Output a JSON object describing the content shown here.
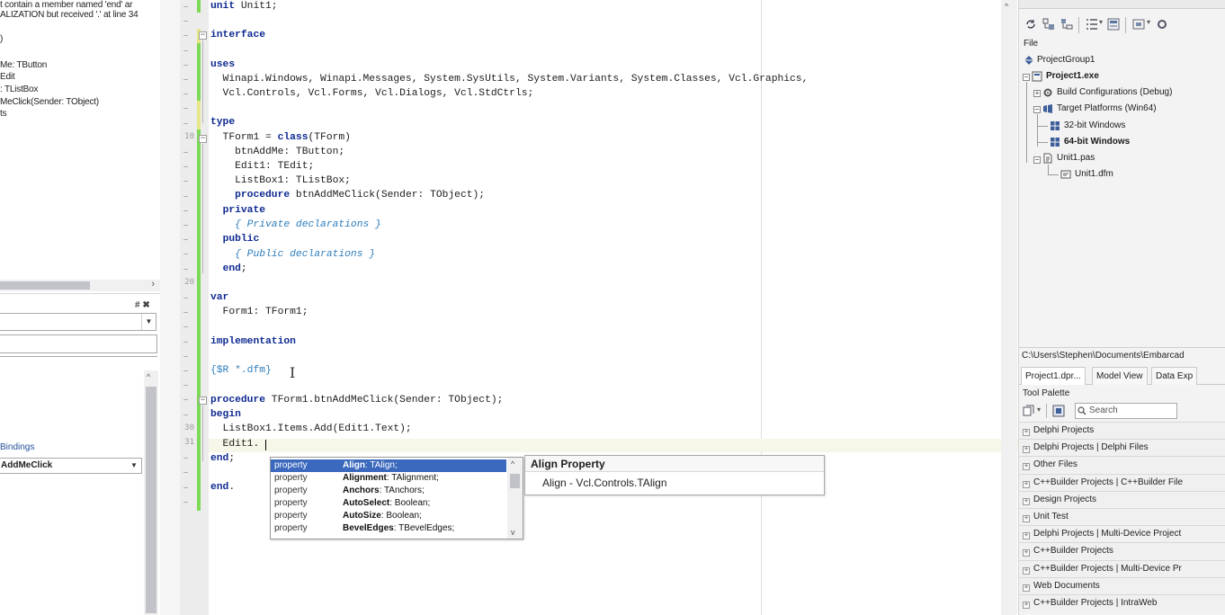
{
  "left_panel": {
    "lines": [
      "t contain a member named 'end' ar",
      "ALIZATION but received '.' at line 34",
      ")",
      "Me: TButton",
      "Edit",
      ": TListBox",
      "MeClick(Sender: TObject)",
      "ts"
    ],
    "pin_label": "# ✖",
    "bindings_label": "Bindings",
    "event_value": "AddMeClick"
  },
  "editor": {
    "line_numbers": [
      "10",
      "20",
      "30",
      "31"
    ],
    "code": {
      "unit_kw": "unit",
      "unit_name": " Unit1;",
      "interface": "interface",
      "uses": "uses",
      "uses1": "  Winapi.Windows, Winapi.Messages, System.SysUtils, System.Variants, System.Classes, Vcl.Graphics,",
      "uses2": "  Vcl.Controls, Vcl.Forms, Vcl.Dialogs, Vcl.StdCtrls;",
      "type": "type",
      "tform_a": "  TForm1 = ",
      "tform_kw": "class",
      "tform_b": "(TForm)",
      "f1": "    btnAddMe: TButton;",
      "f2": "    Edit1: TEdit;",
      "f3": "    ListBox1: TListBox;",
      "proc_kw": "procedure",
      "proc_decl": " btnAddMeClick(Sender: TObject);",
      "private": "private",
      "private_cm": "{ Private declarations }",
      "public": "public",
      "public_cm": "{ Public declarations }",
      "end_class": "end",
      "var": "var",
      "var1": "  Form1: TForm1;",
      "implementation": "implementation",
      "dfm": "{$R *.dfm}",
      "impl_proc_b": " TForm1.btnAddMeClick(Sender: TObject);",
      "begin": "begin",
      "body1": "  ListBox1.Items.Add(Edit1.Text);",
      "body2": "  Edit1.",
      "end_proc": "end",
      "end_unit": "end",
      "semicolon": ";",
      "dot": "."
    }
  },
  "completion": {
    "items": [
      {
        "kind": "property",
        "name": "Align",
        "type": ": TAlign;"
      },
      {
        "kind": "property",
        "name": "Alignment",
        "type": ": TAlignment;"
      },
      {
        "kind": "property",
        "name": "Anchors",
        "type": ": TAnchors;"
      },
      {
        "kind": "property",
        "name": "AutoSelect",
        "type": ": Boolean;"
      },
      {
        "kind": "property",
        "name": "AutoSize",
        "type": ": Boolean;"
      },
      {
        "kind": "property",
        "name": "BevelEdges",
        "type": ": TBevelEdges;"
      }
    ],
    "help_title": "Align Property",
    "help_body": "Align - Vcl.Controls.TAlign"
  },
  "project": {
    "file_label": "File",
    "tree": [
      {
        "label": "ProjectGroup1"
      },
      {
        "label": "Project1.exe"
      },
      {
        "label": "Build Configurations (Debug)"
      },
      {
        "label": "Target Platforms (Win64)"
      },
      {
        "label": "32-bit Windows"
      },
      {
        "label": "64-bit Windows"
      },
      {
        "label": "Unit1.pas"
      },
      {
        "label": "Unit1.dfm"
      }
    ],
    "path": "C:\\Users\\Stephen\\Documents\\Embarcad",
    "tabs": [
      "Project1.dpr...",
      "Model View",
      "Data Exp"
    ]
  },
  "palette": {
    "title": "Tool Palette",
    "search_placeholder": "Search",
    "categories": [
      "Delphi Projects",
      "Delphi Projects | Delphi Files",
      "Other Files",
      "C++Builder Projects | C++Builder File",
      "Design Projects",
      "Unit Test",
      "Delphi Projects | Multi-Device Project",
      "C++Builder Projects",
      "C++Builder Projects | Multi-Device Pr",
      "Web Documents",
      "C++Builder Projects | IntraWeb"
    ]
  },
  "colors": {
    "keyword": "#0e2a91",
    "comment": "#2e7dbb",
    "selection": "#3b69bd",
    "change_bar": "#7ed957",
    "change_bar_saved": "#e7e78a"
  }
}
